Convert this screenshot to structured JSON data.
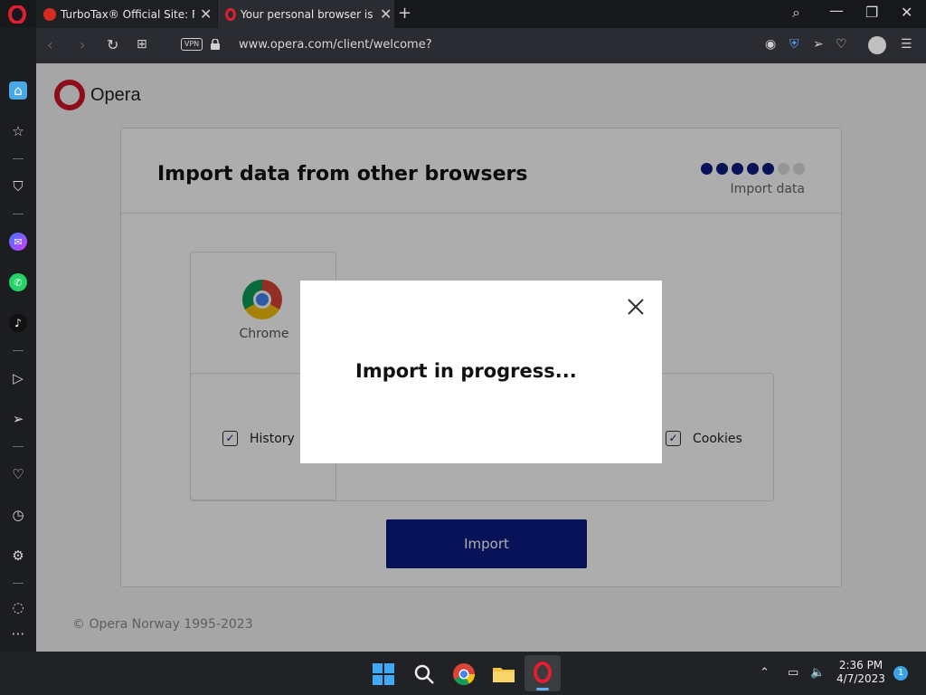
{
  "tabs": [
    {
      "title": "TurboTax® Official Site: File",
      "close": "✕"
    },
    {
      "title": "Your personal browser is al",
      "close": "✕"
    }
  ],
  "new_tab": "+",
  "address_bar": {
    "vpn_label": "VPN",
    "url": "www.opera.com/client/welcome?"
  },
  "page": {
    "logo_text": "Opera",
    "card_title": "Import data from other browsers",
    "step_label": "Import data",
    "steps_total": 7,
    "steps_done": 5,
    "browser_name": "Chrome",
    "options": [
      "History",
      "Cookies"
    ],
    "import_button": "Import",
    "footer": "© Opera Norway 1995-2023"
  },
  "modal": {
    "message": "Import in progress..."
  },
  "taskbar": {
    "time": "2:36 PM",
    "date": "4/7/2023",
    "notifications": "1"
  },
  "colors": {
    "accent": "#0b1b82",
    "opera_red": "#d1122a"
  }
}
